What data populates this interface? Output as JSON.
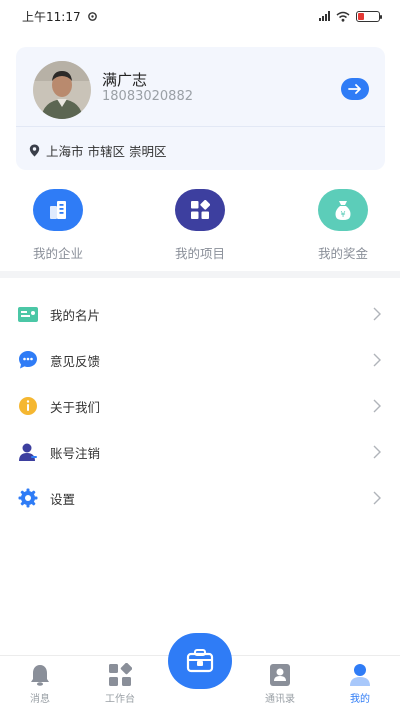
{
  "status": {
    "time": "上午11:17"
  },
  "profile": {
    "name": "满广志",
    "phone": "18083020882",
    "location": "上海市 市辖区 崇明区"
  },
  "quick_actions": [
    {
      "label": "我的企业",
      "icon": "company-icon",
      "color": "#2f7cf6"
    },
    {
      "label": "我的项目",
      "icon": "project-icon",
      "color": "#3d3f9f"
    },
    {
      "label": "我的奖金",
      "icon": "bonus-icon",
      "color": "#5ccdb9"
    }
  ],
  "menu": [
    {
      "label": "我的名片",
      "icon": "business-card-icon",
      "color": "#4bc7a6"
    },
    {
      "label": "意见反馈",
      "icon": "feedback-icon",
      "color": "#2f7cf6"
    },
    {
      "label": "关于我们",
      "icon": "info-icon",
      "color": "#f5b731"
    },
    {
      "label": "账号注销",
      "icon": "account-icon",
      "color": "#3d3f9f"
    },
    {
      "label": "设置",
      "icon": "settings-icon",
      "color": "#2f7cf6"
    }
  ],
  "tabs": [
    {
      "label": "消息",
      "icon": "bell-icon"
    },
    {
      "label": "工作台",
      "icon": "workbench-icon"
    },
    {
      "label": "通讯录",
      "icon": "contacts-icon"
    },
    {
      "label": "我的",
      "icon": "profile-icon",
      "active": true
    }
  ],
  "colors": {
    "accent": "#2f7cf6",
    "card_bg": "#f3f6fd"
  }
}
